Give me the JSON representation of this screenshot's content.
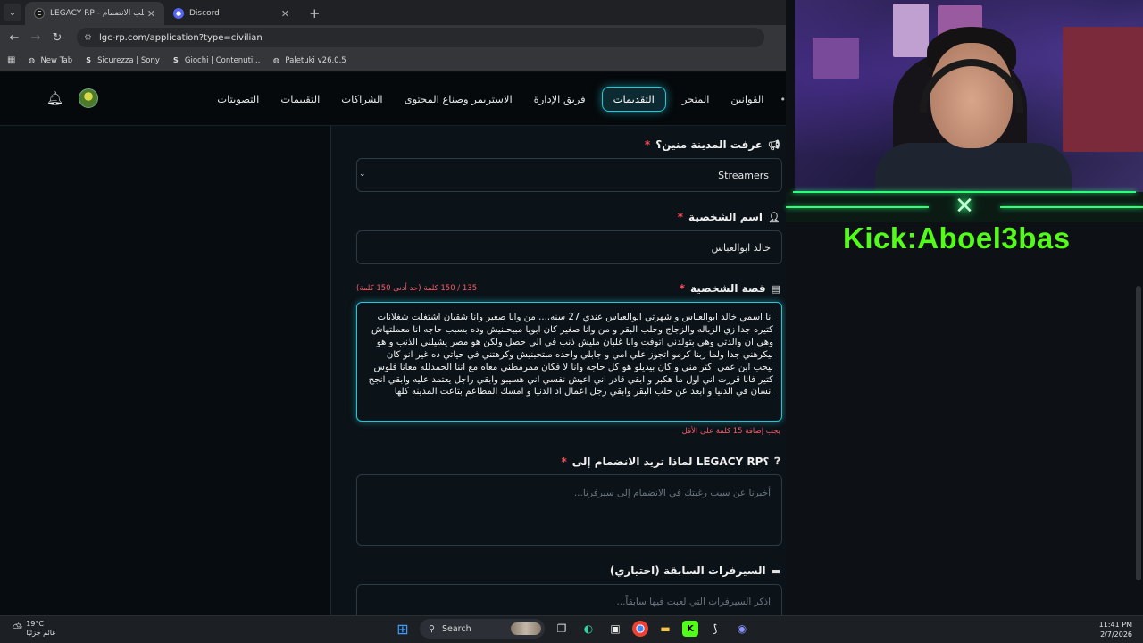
{
  "browser": {
    "tabs": [
      {
        "title": "LEGACY RP - تقديم طلب الانضمام",
        "active": true
      },
      {
        "title": "Discord",
        "active": false
      }
    ],
    "url": "lgc-rp.com/application?type=civilian",
    "bookmarks": [
      "New Tab",
      "Sicurezza | Sony",
      "Giochi | Contenuti...",
      "Paletuki v26.0.5"
    ]
  },
  "site_nav": {
    "items": [
      "القوانين",
      "المتجر",
      "التقديمات",
      "فريق الإدارة",
      "الاستريمر وصناع المحتوى",
      "الشراكات",
      "التقييمات",
      "التصويتات"
    ],
    "active_index": 2
  },
  "form": {
    "source": {
      "label": "عرفت المدينة منين؟",
      "value": "Streamers"
    },
    "character_name": {
      "label": "اسم الشخصية",
      "value": "خالد ابوالعباس"
    },
    "story": {
      "label": "قصة الشخصية",
      "word_count": "135 / 150 كلمة (حد أدنى 150 كلمة)",
      "value": "انا اسمي خالد ابوالعباس و شهرتي ابوالعباس  عندي 27 سنه....  من وانا صغير وانا شقيان اشتغلت شغلانات كتيره جدا زي الزباله والزجاج  وحلب البقر  و من وانا صغير كان ابويا مبيحبنيش وده بسبب حاجه انا معملتهاش وهي ان والدتي وهي بتولدني اتوفت وانا غلبان مليش ذنب في الي حصل ولكن هو مصر يشيلني الذنب و هو بيكرهني جدا  ولما ربنا كرمو اتجوز علي امي و جابلي واحده مبتحبنيش وكرهتني في حياتي ده غير انو كان بيحب ابن عمي اكتر مني و كان بيديلو هو كل حاجه وانا لا فكان ممرمطني معاه مع اننا الحمدلله معانا فلوس كتير فانا قررت اني اول ما هكبر و ابقي قادر اني اعيش نفسي اني هسيبو وابقي راجل يعتمد عليه وابقي انجح  انسان في الدنيا و ابعد عن  حلب البقر وابقي رجل اعمال اد الدنيا و امسك المطاعم بتاعت المدينه كلها",
      "warning": "يجب إضافة 15 كلمة على الأقل"
    },
    "why_join": {
      "label": "لماذا تريد الانضمام إلى LEGACY RP؟",
      "placeholder": "أخبرنا عن سبب رغبتك في الانضمام إلى سيرفرنا..."
    },
    "previous_servers": {
      "label": "السيرفرات السابقة (اختياري)",
      "placeholder": "اذكر السيرفرات التي لعبت فيها سابقاً..."
    }
  },
  "stream_overlay": {
    "handle": "Kick:Aboel3bas",
    "accent": "#53fc18"
  },
  "taskbar": {
    "weather_temp": "19°C",
    "weather_desc": "غائم جزئيًا",
    "search_label": "Search",
    "time": "11:41 PM",
    "date": "2/7/2026"
  }
}
